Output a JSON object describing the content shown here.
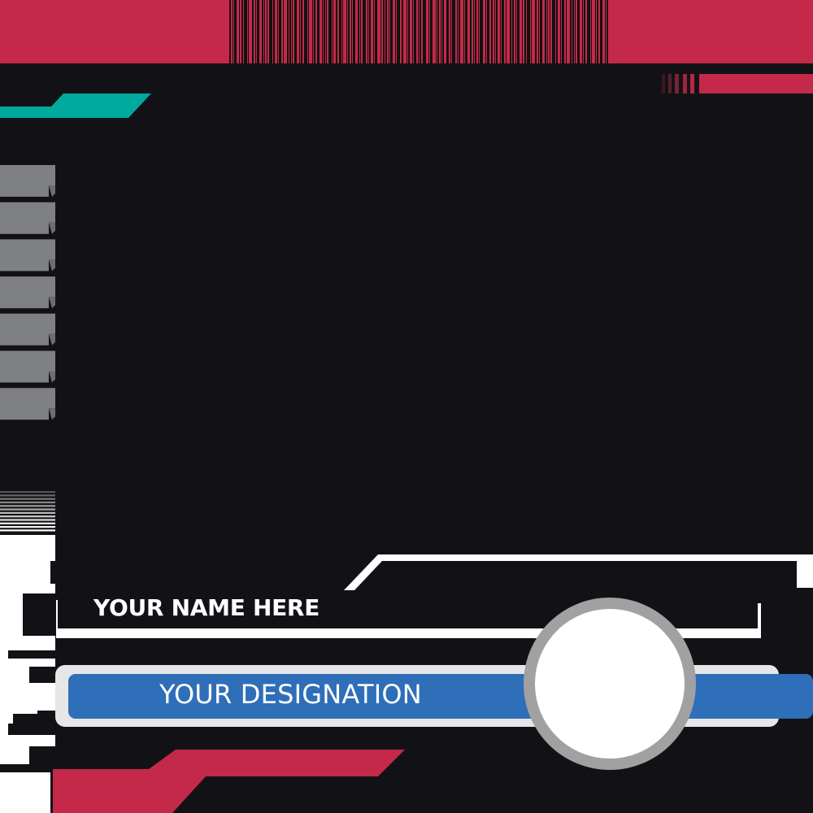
{
  "card": {
    "name_placeholder": "YOUR NAME HERE",
    "designation_placeholder": "YOUR DESIGNATION"
  },
  "colors": {
    "background": "#121216",
    "crimson": "#c4294a",
    "teal": "#00a99d",
    "blue": "#2f6eb8",
    "light_gray": "#e6e6e6",
    "gray": "#7f8082",
    "white": "#ffffff"
  },
  "decor": {
    "barcode": "barcode-icon",
    "photo_frame": "circle-photo-frame"
  }
}
